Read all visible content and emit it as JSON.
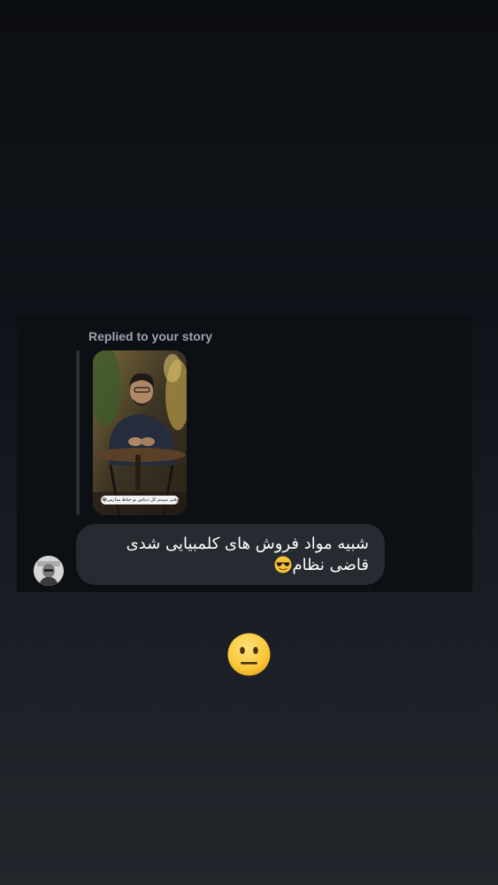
{
  "story_reply": {
    "label": "Replied to your story",
    "story_caption": "وقتی میبینم کل دنیاش تو حیاط مدارس😂🥲"
  },
  "message": {
    "text": "شبیه مواد فروش های کلمبیایی شدی قاضی نظام",
    "emoji": "smiling-face-with-sunglasses"
  },
  "reaction": {
    "emoji": "neutral-face"
  },
  "colors": {
    "card_bg": "#0c1015",
    "bubble_bg": "#262a31",
    "label_color": "#9aa3ad",
    "emoji_yellow": "#f7c236"
  }
}
